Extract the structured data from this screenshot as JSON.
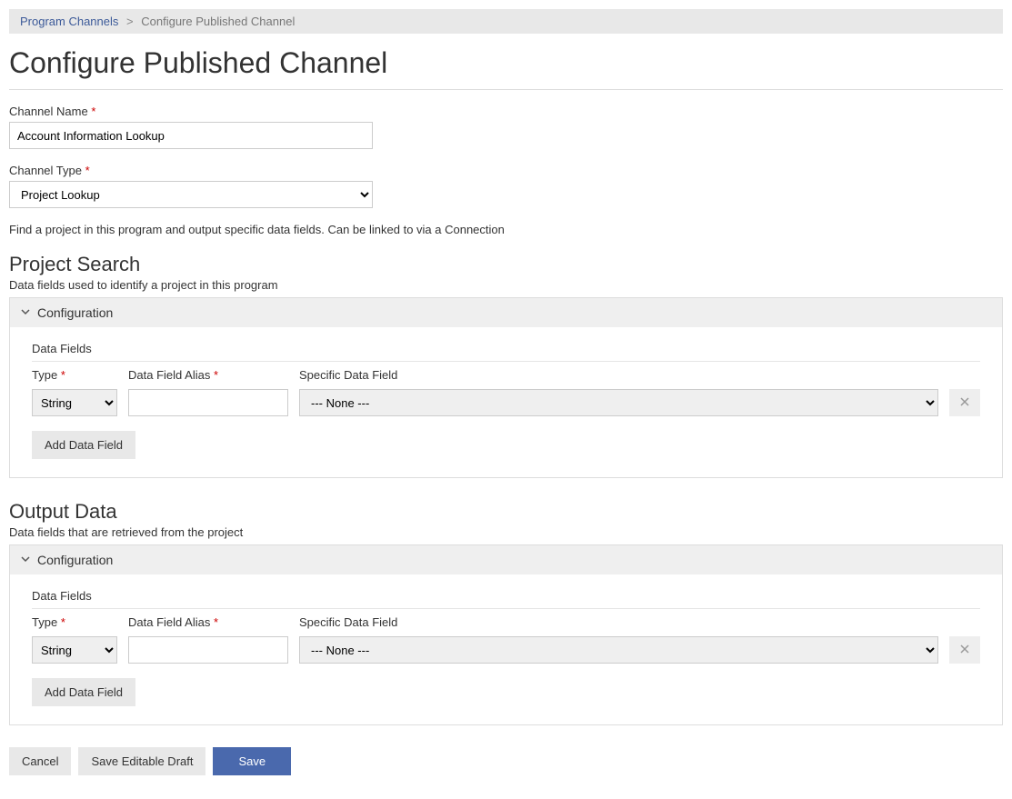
{
  "breadcrumb": {
    "parent": "Program Channels",
    "current": "Configure Published Channel"
  },
  "page_title": "Configure Published Channel",
  "channel_name": {
    "label": "Channel Name",
    "value": "Account Information Lookup"
  },
  "channel_type": {
    "label": "Channel Type",
    "value": "Project Lookup",
    "help": "Find a project in this program and output specific data fields. Can be linked to via a Connection"
  },
  "project_search": {
    "title": "Project Search",
    "desc": "Data fields used to identify a project in this program",
    "panel_header": "Configuration",
    "data_fields_label": "Data Fields",
    "columns": {
      "type": "Type",
      "alias": "Data Field Alias",
      "specific": "Specific Data Field"
    },
    "row": {
      "type": "String",
      "alias": "",
      "specific": "--- None ---"
    },
    "add_button": "Add Data Field"
  },
  "output_data": {
    "title": "Output Data",
    "desc": "Data fields that are retrieved from the project",
    "panel_header": "Configuration",
    "data_fields_label": "Data Fields",
    "columns": {
      "type": "Type",
      "alias": "Data Field Alias",
      "specific": "Specific Data Field"
    },
    "row": {
      "type": "String",
      "alias": "",
      "specific": "--- None ---"
    },
    "add_button": "Add Data Field"
  },
  "actions": {
    "cancel": "Cancel",
    "save_draft": "Save Editable Draft",
    "save": "Save"
  }
}
